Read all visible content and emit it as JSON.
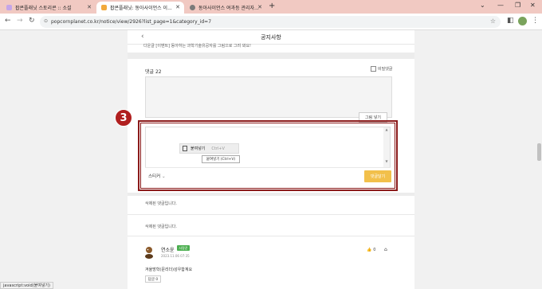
{
  "browser": {
    "tabs": [
      {
        "label": "팝콘플래닛 스토리콘 :: 소설",
        "active": false
      },
      {
        "label": "팝콘플래닛: 동아사이언스 이...",
        "active": true
      },
      {
        "label": "동아사이언스 여과등 관리자...",
        "active": false
      }
    ],
    "new_tab": "+",
    "url": "popcornplanet.co.kr/notice/view/2926?list_page=1&category_id=7",
    "status_text": "javascript:void(붙여넣기)"
  },
  "page": {
    "title": "공지사항",
    "snippet": "다운글 [이벤트] 동아하는 과학기술유공자를 그림으로 그려 봐요!",
    "comments_header": "댓글 22",
    "secret_label": "비밀댓글",
    "image_button": "그림 넣기",
    "callout_number": "3",
    "context_menu": {
      "label": "붙여넣기",
      "shortcut": "Ctrl+V"
    },
    "tooltip": "붙여넣기 (Ctrl+V)",
    "sticker_label": "스티커",
    "submit_label": "댓글달기",
    "deleted_1": "삭제된 댓글입니다.",
    "deleted_2": "삭제된 댓글입니다.",
    "comment": {
      "author": "연소윤",
      "badge": "사랑꾼",
      "date": "2023.11.06 07:35",
      "likes": "0",
      "text": "겨울방학(문리더)성우합계요",
      "reply_label": "답글 0"
    }
  },
  "colors": {
    "accent_red": "#8b1a1a",
    "submit_yellow": "#f2c04b",
    "tabbar": "#f1c9c2"
  }
}
